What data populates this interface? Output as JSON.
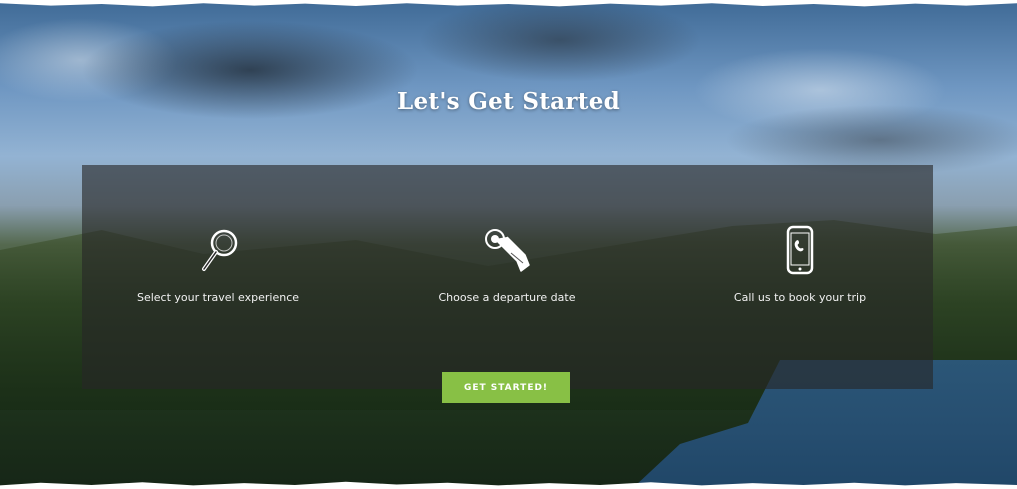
{
  "hero": {
    "title": "Let's Get Started"
  },
  "steps": [
    {
      "icon": "magnifier-icon",
      "label": "Select your travel experience"
    },
    {
      "icon": "touch-hand-icon",
      "label": "Choose a departure date"
    },
    {
      "icon": "phone-icon",
      "label": "Call us to book your trip"
    }
  ],
  "cta": {
    "label": "GET STARTED!",
    "color": "#88c045"
  }
}
